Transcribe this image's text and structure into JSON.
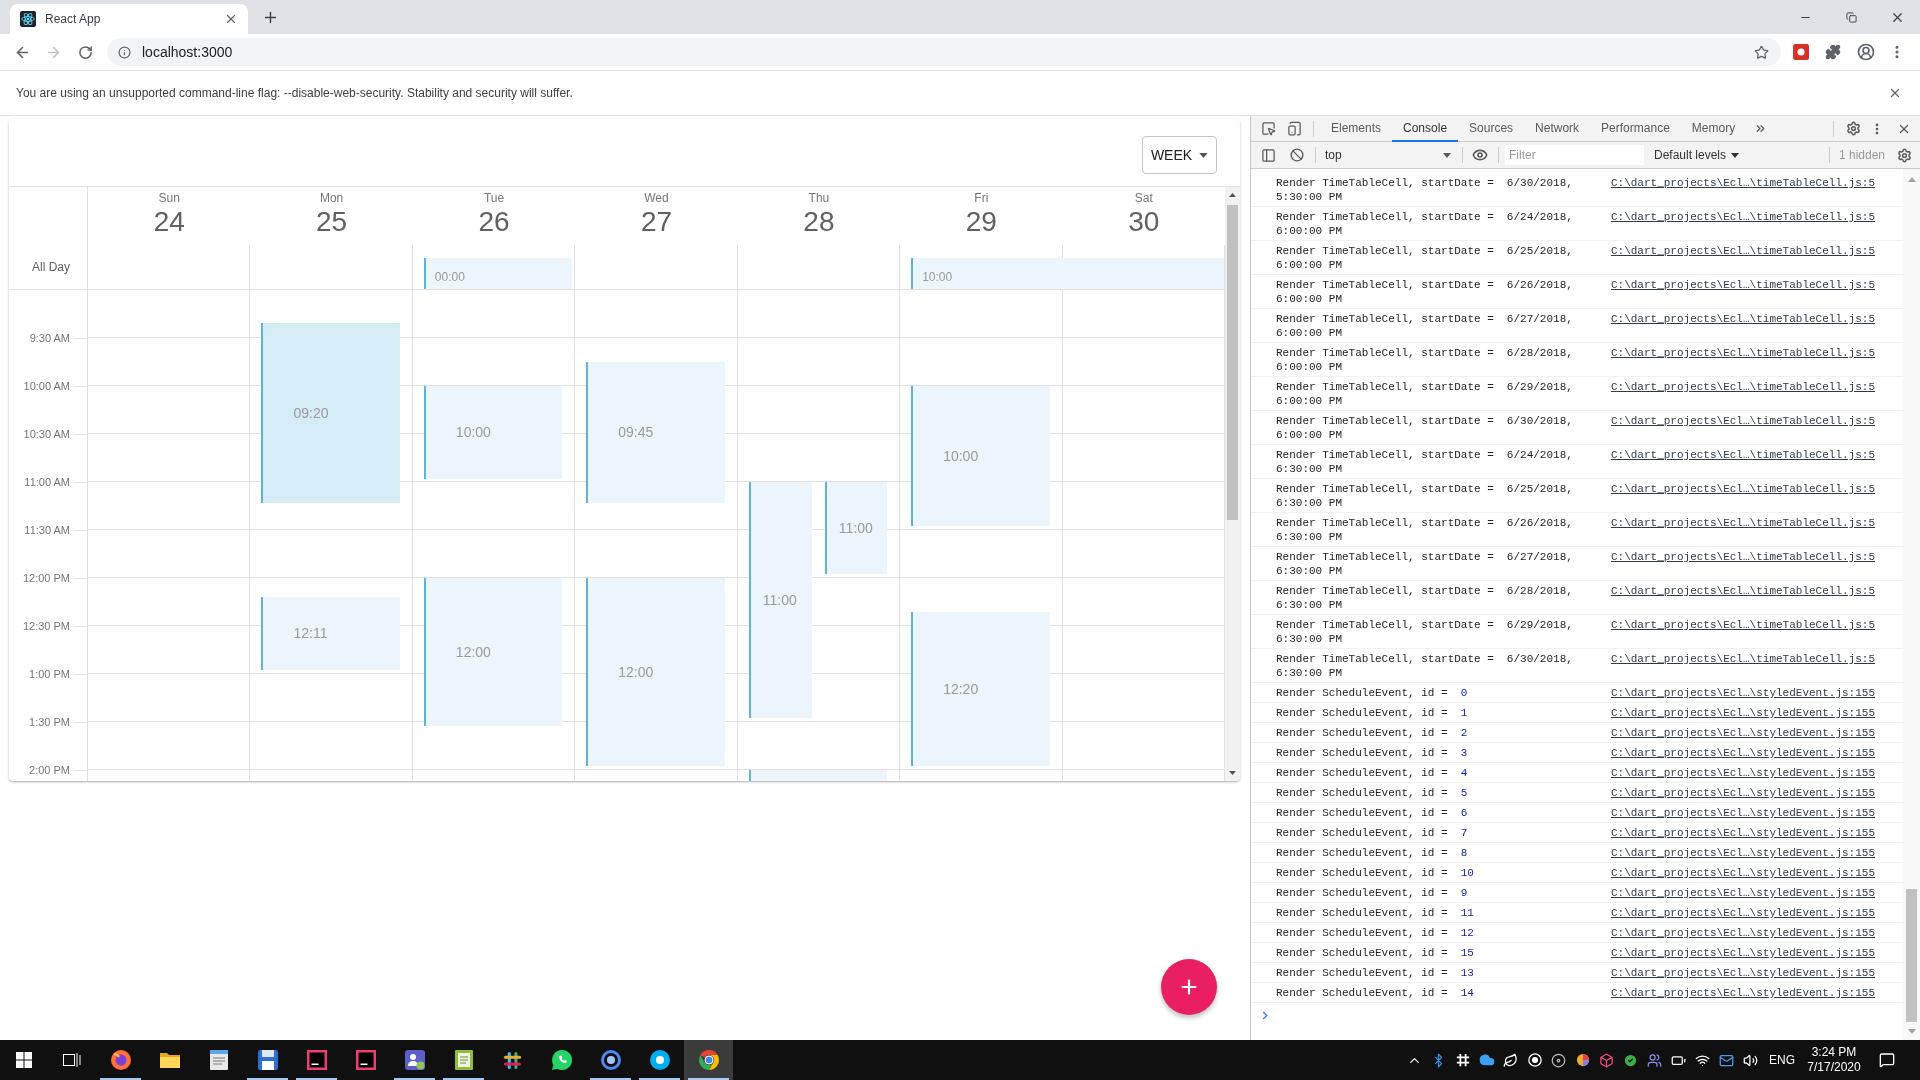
{
  "browser": {
    "tab": {
      "title": "React App"
    },
    "back_button": {
      "disabled": false
    },
    "forward_button": {
      "disabled": true
    },
    "address": "localhost:3000",
    "infobar": "You are using an unsupported command-line flag: --disable-web-security. Stability and security will suffer."
  },
  "calendar": {
    "view_button": "WEEK",
    "all_day_label": "All Day",
    "days": [
      {
        "name": "Sun",
        "date": "24"
      },
      {
        "name": "Mon",
        "date": "25",
        "events": [
          {
            "start": "09:20",
            "selected": true
          },
          {
            "start": "12:11",
            "selected": false
          }
        ]
      },
      {
        "name": "Tue",
        "date": "26",
        "all_day": [
          {
            "start": "00:00",
            "selected": false
          }
        ],
        "events": [
          {
            "start": "10:00",
            "selected": false
          },
          {
            "start": "12:00",
            "selected": false
          }
        ]
      },
      {
        "name": "Wed",
        "date": "27",
        "events": [
          {
            "start": "09:45",
            "selected": false
          },
          {
            "start": "12:00",
            "selected": false
          }
        ]
      },
      {
        "name": "Thu",
        "date": "28",
        "events": [
          {
            "start": "11:00",
            "selected": false
          },
          {
            "start": "11:00",
            "selected": false
          },
          {
            "selected": false
          }
        ]
      },
      {
        "name": "Fri",
        "date": "29",
        "all_day": [
          {
            "start": "10:00",
            "selected": false
          }
        ],
        "events": [
          {
            "start": "10:00",
            "selected": false
          },
          {
            "start": "12:20",
            "selected": false
          }
        ]
      },
      {
        "name": "Sat",
        "date": "30"
      }
    ],
    "time_labels": [
      "9:30 AM",
      "10:00 AM",
      "10:30 AM",
      "11:00 AM",
      "11:30 AM",
      "12:00 PM",
      "12:30 PM",
      "1:00 PM",
      "1:30 PM",
      "2:00 PM"
    ]
  },
  "devtools": {
    "tabs": [
      {
        "label": "Elements",
        "selected": false
      },
      {
        "label": "Console",
        "selected": true
      },
      {
        "label": "Sources",
        "selected": false
      },
      {
        "label": "Network",
        "selected": false
      },
      {
        "label": "Performance",
        "selected": false
      },
      {
        "label": "Memory",
        "selected": false
      }
    ],
    "context": "top",
    "filter": {
      "placeholder": "Filter"
    },
    "levels": "Default levels",
    "hidden": "1 hidden",
    "logs": [
      {
        "kind": "date",
        "message": "Render TimeTableCell, startDate =",
        "value": "6/30/2018, 5:30:00 PM",
        "source": "C:\\dart_projects\\Ecl…\\timeTableCell.js:5"
      },
      {
        "kind": "date",
        "message": "Render TimeTableCell, startDate =",
        "value": "6/24/2018, 6:00:00 PM",
        "source": "C:\\dart_projects\\Ecl…\\timeTableCell.js:5"
      },
      {
        "kind": "date",
        "message": "Render TimeTableCell, startDate =",
        "value": "6/25/2018, 6:00:00 PM",
        "source": "C:\\dart_projects\\Ecl…\\timeTableCell.js:5"
      },
      {
        "kind": "date",
        "message": "Render TimeTableCell, startDate =",
        "value": "6/26/2018, 6:00:00 PM",
        "source": "C:\\dart_projects\\Ecl…\\timeTableCell.js:5"
      },
      {
        "kind": "date",
        "message": "Render TimeTableCell, startDate =",
        "value": "6/27/2018, 6:00:00 PM",
        "source": "C:\\dart_projects\\Ecl…\\timeTableCell.js:5"
      },
      {
        "kind": "date",
        "message": "Render TimeTableCell, startDate =",
        "value": "6/28/2018, 6:00:00 PM",
        "source": "C:\\dart_projects\\Ecl…\\timeTableCell.js:5"
      },
      {
        "kind": "date",
        "message": "Render TimeTableCell, startDate =",
        "value": "6/29/2018, 6:00:00 PM",
        "source": "C:\\dart_projects\\Ecl…\\timeTableCell.js:5"
      },
      {
        "kind": "date",
        "message": "Render TimeTableCell, startDate =",
        "value": "6/30/2018, 6:00:00 PM",
        "source": "C:\\dart_projects\\Ecl…\\timeTableCell.js:5"
      },
      {
        "kind": "date",
        "message": "Render TimeTableCell, startDate =",
        "value": "6/24/2018, 6:30:00 PM",
        "source": "C:\\dart_projects\\Ecl…\\timeTableCell.js:5"
      },
      {
        "kind": "date",
        "message": "Render TimeTableCell, startDate =",
        "value": "6/25/2018, 6:30:00 PM",
        "source": "C:\\dart_projects\\Ecl…\\timeTableCell.js:5"
      },
      {
        "kind": "date",
        "message": "Render TimeTableCell, startDate =",
        "value": "6/26/2018, 6:30:00 PM",
        "source": "C:\\dart_projects\\Ecl…\\timeTableCell.js:5"
      },
      {
        "kind": "date",
        "message": "Render TimeTableCell, startDate =",
        "value": "6/27/2018, 6:30:00 PM",
        "source": "C:\\dart_projects\\Ecl…\\timeTableCell.js:5"
      },
      {
        "kind": "date",
        "message": "Render TimeTableCell, startDate =",
        "value": "6/28/2018, 6:30:00 PM",
        "source": "C:\\dart_projects\\Ecl…\\timeTableCell.js:5"
      },
      {
        "kind": "date",
        "message": "Render TimeTableCell, startDate =",
        "value": "6/29/2018, 6:30:00 PM",
        "source": "C:\\dart_projects\\Ecl…\\timeTableCell.js:5"
      },
      {
        "kind": "date",
        "message": "Render TimeTableCell, startDate =",
        "value": "6/30/2018, 6:30:00 PM",
        "source": "C:\\dart_projects\\Ecl…\\timeTableCell.js:5"
      },
      {
        "kind": "number",
        "message": "Render ScheduleEvent, id =",
        "value": "0",
        "source": "C:\\dart_projects\\Ecl…\\styledEvent.js:155"
      },
      {
        "kind": "number",
        "message": "Render ScheduleEvent, id =",
        "value": "1",
        "source": "C:\\dart_projects\\Ecl…\\styledEvent.js:155"
      },
      {
        "kind": "number",
        "message": "Render ScheduleEvent, id =",
        "value": "2",
        "source": "C:\\dart_projects\\Ecl…\\styledEvent.js:155"
      },
      {
        "kind": "number",
        "message": "Render ScheduleEvent, id =",
        "value": "3",
        "source": "C:\\dart_projects\\Ecl…\\styledEvent.js:155"
      },
      {
        "kind": "number",
        "message": "Render ScheduleEvent, id =",
        "value": "4",
        "source": "C:\\dart_projects\\Ecl…\\styledEvent.js:155"
      },
      {
        "kind": "number",
        "message": "Render ScheduleEvent, id =",
        "value": "5",
        "source": "C:\\dart_projects\\Ecl…\\styledEvent.js:155"
      },
      {
        "kind": "number",
        "message": "Render ScheduleEvent, id =",
        "value": "6",
        "source": "C:\\dart_projects\\Ecl…\\styledEvent.js:155"
      },
      {
        "kind": "number",
        "message": "Render ScheduleEvent, id =",
        "value": "7",
        "source": "C:\\dart_projects\\Ecl…\\styledEvent.js:155"
      },
      {
        "kind": "number",
        "message": "Render ScheduleEvent, id =",
        "value": "8",
        "source": "C:\\dart_projects\\Ecl…\\styledEvent.js:155"
      },
      {
        "kind": "number",
        "message": "Render ScheduleEvent, id =",
        "value": "10",
        "source": "C:\\dart_projects\\Ecl…\\styledEvent.js:155"
      },
      {
        "kind": "number",
        "message": "Render ScheduleEvent, id =",
        "value": "9",
        "source": "C:\\dart_projects\\Ecl…\\styledEvent.js:155"
      },
      {
        "kind": "number",
        "message": "Render ScheduleEvent, id =",
        "value": "11",
        "source": "C:\\dart_projects\\Ecl…\\styledEvent.js:155"
      },
      {
        "kind": "number",
        "message": "Render ScheduleEvent, id =",
        "value": "12",
        "source": "C:\\dart_projects\\Ecl…\\styledEvent.js:155"
      },
      {
        "kind": "number",
        "message": "Render ScheduleEvent, id =",
        "value": "15",
        "source": "C:\\dart_projects\\Ecl…\\styledEvent.js:155"
      },
      {
        "kind": "number",
        "message": "Render ScheduleEvent, id =",
        "value": "13",
        "source": "C:\\dart_projects\\Ecl…\\styledEvent.js:155"
      },
      {
        "kind": "number",
        "message": "Render ScheduleEvent, id =",
        "value": "14",
        "source": "C:\\dart_projects\\Ecl…\\styledEvent.js:155"
      }
    ]
  },
  "taskbar": {
    "apps": [
      {
        "kind": "globe",
        "running": true,
        "selected": false
      },
      {
        "kind": "folder",
        "running": false,
        "selected": false
      },
      {
        "kind": "notepad",
        "running": false,
        "selected": false
      },
      {
        "kind": "floppy",
        "running": true,
        "selected": false
      },
      {
        "kind": "tile",
        "running": true,
        "selected": false
      },
      {
        "kind": "tile",
        "running": false,
        "selected": false
      },
      {
        "kind": "team",
        "running": true,
        "selected": false
      },
      {
        "kind": "notebook",
        "running": true,
        "selected": false
      },
      {
        "kind": "hash",
        "running": false,
        "selected": false
      },
      {
        "kind": "chat",
        "running": false,
        "selected": false
      },
      {
        "kind": "ring",
        "running": true,
        "selected": false
      },
      {
        "kind": "bubble",
        "running": true,
        "selected": false
      },
      {
        "kind": "browser",
        "running": true,
        "selected": true
      }
    ],
    "language": "ENG",
    "time": "3:24 PM",
    "date": "7/17/2020"
  }
}
